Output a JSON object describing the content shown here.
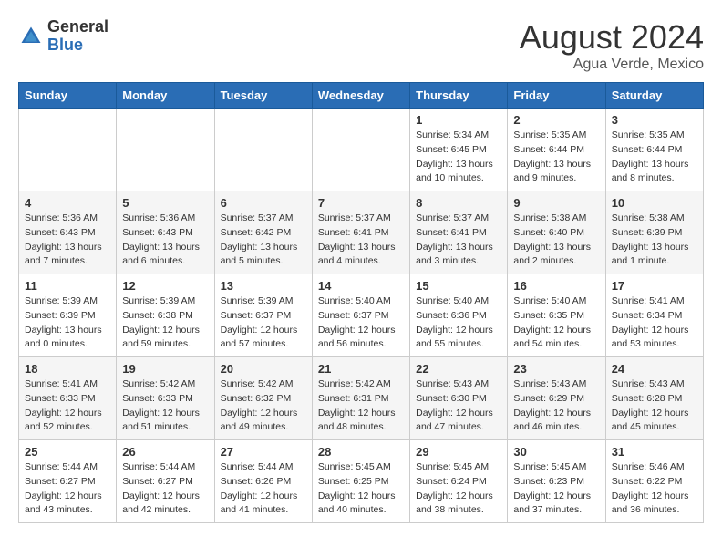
{
  "header": {
    "logo_general": "General",
    "logo_blue": "Blue",
    "month_title": "August 2024",
    "location": "Agua Verde, Mexico"
  },
  "days_of_week": [
    "Sunday",
    "Monday",
    "Tuesday",
    "Wednesday",
    "Thursday",
    "Friday",
    "Saturday"
  ],
  "weeks": [
    [
      {
        "day": "",
        "info": ""
      },
      {
        "day": "",
        "info": ""
      },
      {
        "day": "",
        "info": ""
      },
      {
        "day": "",
        "info": ""
      },
      {
        "day": "1",
        "info": "Sunrise: 5:34 AM\nSunset: 6:45 PM\nDaylight: 13 hours\nand 10 minutes."
      },
      {
        "day": "2",
        "info": "Sunrise: 5:35 AM\nSunset: 6:44 PM\nDaylight: 13 hours\nand 9 minutes."
      },
      {
        "day": "3",
        "info": "Sunrise: 5:35 AM\nSunset: 6:44 PM\nDaylight: 13 hours\nand 8 minutes."
      }
    ],
    [
      {
        "day": "4",
        "info": "Sunrise: 5:36 AM\nSunset: 6:43 PM\nDaylight: 13 hours\nand 7 minutes."
      },
      {
        "day": "5",
        "info": "Sunrise: 5:36 AM\nSunset: 6:43 PM\nDaylight: 13 hours\nand 6 minutes."
      },
      {
        "day": "6",
        "info": "Sunrise: 5:37 AM\nSunset: 6:42 PM\nDaylight: 13 hours\nand 5 minutes."
      },
      {
        "day": "7",
        "info": "Sunrise: 5:37 AM\nSunset: 6:41 PM\nDaylight: 13 hours\nand 4 minutes."
      },
      {
        "day": "8",
        "info": "Sunrise: 5:37 AM\nSunset: 6:41 PM\nDaylight: 13 hours\nand 3 minutes."
      },
      {
        "day": "9",
        "info": "Sunrise: 5:38 AM\nSunset: 6:40 PM\nDaylight: 13 hours\nand 2 minutes."
      },
      {
        "day": "10",
        "info": "Sunrise: 5:38 AM\nSunset: 6:39 PM\nDaylight: 13 hours\nand 1 minute."
      }
    ],
    [
      {
        "day": "11",
        "info": "Sunrise: 5:39 AM\nSunset: 6:39 PM\nDaylight: 13 hours\nand 0 minutes."
      },
      {
        "day": "12",
        "info": "Sunrise: 5:39 AM\nSunset: 6:38 PM\nDaylight: 12 hours\nand 59 minutes."
      },
      {
        "day": "13",
        "info": "Sunrise: 5:39 AM\nSunset: 6:37 PM\nDaylight: 12 hours\nand 57 minutes."
      },
      {
        "day": "14",
        "info": "Sunrise: 5:40 AM\nSunset: 6:37 PM\nDaylight: 12 hours\nand 56 minutes."
      },
      {
        "day": "15",
        "info": "Sunrise: 5:40 AM\nSunset: 6:36 PM\nDaylight: 12 hours\nand 55 minutes."
      },
      {
        "day": "16",
        "info": "Sunrise: 5:40 AM\nSunset: 6:35 PM\nDaylight: 12 hours\nand 54 minutes."
      },
      {
        "day": "17",
        "info": "Sunrise: 5:41 AM\nSunset: 6:34 PM\nDaylight: 12 hours\nand 53 minutes."
      }
    ],
    [
      {
        "day": "18",
        "info": "Sunrise: 5:41 AM\nSunset: 6:33 PM\nDaylight: 12 hours\nand 52 minutes."
      },
      {
        "day": "19",
        "info": "Sunrise: 5:42 AM\nSunset: 6:33 PM\nDaylight: 12 hours\nand 51 minutes."
      },
      {
        "day": "20",
        "info": "Sunrise: 5:42 AM\nSunset: 6:32 PM\nDaylight: 12 hours\nand 49 minutes."
      },
      {
        "day": "21",
        "info": "Sunrise: 5:42 AM\nSunset: 6:31 PM\nDaylight: 12 hours\nand 48 minutes."
      },
      {
        "day": "22",
        "info": "Sunrise: 5:43 AM\nSunset: 6:30 PM\nDaylight: 12 hours\nand 47 minutes."
      },
      {
        "day": "23",
        "info": "Sunrise: 5:43 AM\nSunset: 6:29 PM\nDaylight: 12 hours\nand 46 minutes."
      },
      {
        "day": "24",
        "info": "Sunrise: 5:43 AM\nSunset: 6:28 PM\nDaylight: 12 hours\nand 45 minutes."
      }
    ],
    [
      {
        "day": "25",
        "info": "Sunrise: 5:44 AM\nSunset: 6:27 PM\nDaylight: 12 hours\nand 43 minutes."
      },
      {
        "day": "26",
        "info": "Sunrise: 5:44 AM\nSunset: 6:27 PM\nDaylight: 12 hours\nand 42 minutes."
      },
      {
        "day": "27",
        "info": "Sunrise: 5:44 AM\nSunset: 6:26 PM\nDaylight: 12 hours\nand 41 minutes."
      },
      {
        "day": "28",
        "info": "Sunrise: 5:45 AM\nSunset: 6:25 PM\nDaylight: 12 hours\nand 40 minutes."
      },
      {
        "day": "29",
        "info": "Sunrise: 5:45 AM\nSunset: 6:24 PM\nDaylight: 12 hours\nand 38 minutes."
      },
      {
        "day": "30",
        "info": "Sunrise: 5:45 AM\nSunset: 6:23 PM\nDaylight: 12 hours\nand 37 minutes."
      },
      {
        "day": "31",
        "info": "Sunrise: 5:46 AM\nSunset: 6:22 PM\nDaylight: 12 hours\nand 36 minutes."
      }
    ]
  ]
}
